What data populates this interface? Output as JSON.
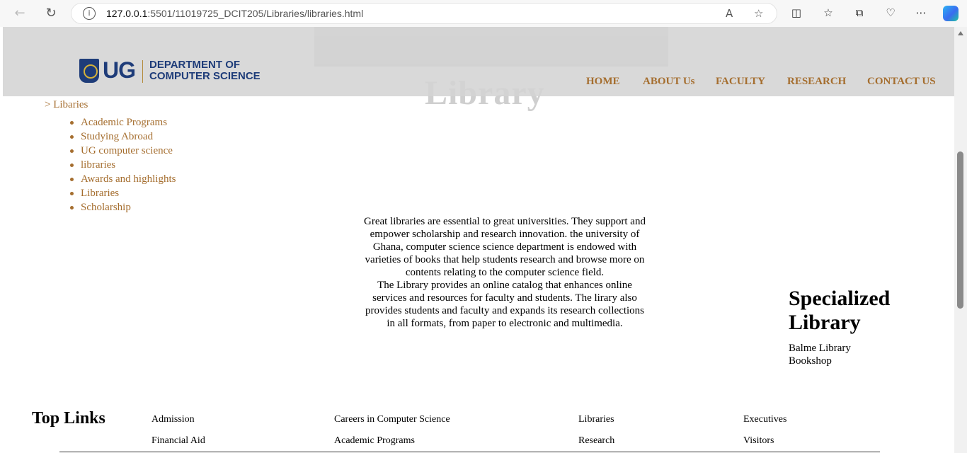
{
  "browser": {
    "url_host": "127.0.0.1",
    "url_path": ":5501/11019725_DCIT205/Libraries/libraries.html"
  },
  "header": {
    "logo_ug": "UG",
    "logo_dept_line1": "DEPARTMENT OF",
    "logo_dept_line2": "COMPUTER SCIENCE",
    "hero_title": "Library",
    "menu": [
      "HOME",
      "ABOUT Us",
      "FACULTY",
      "RESEARCH",
      "CONTACT US"
    ]
  },
  "sidebar": {
    "crumb": "> Libaries",
    "items": [
      "Academic Programs",
      "Studying Abroad",
      "UG computer science",
      "libraries",
      "Awards and highlights",
      "Libraries",
      "Scholarship"
    ]
  },
  "main": {
    "paragraph1": "Great libraries are essential to great universities. They support and empower scholarship and research innovation. the university of Ghana, computer science science department is endowed with varieties of books that help students research and browse more on contents relating to the computer science field.",
    "paragraph2": "The Library provides an online catalog that enhances online services and resources for faculty and students. The lirary also provides students and faculty and expands its research collections in all formats, from paper to electronic and multimedia."
  },
  "specialized": {
    "title": "Specialized Library",
    "items": [
      "Balme Library",
      "Bookshop"
    ]
  },
  "footer": {
    "title": "Top Links",
    "col1": [
      "Admission",
      "Financial Aid"
    ],
    "col2": [
      "Careers in Computer Science",
      "Academic Programs"
    ],
    "col3": [
      "Libraries",
      "Research"
    ],
    "col4": [
      "Executives",
      "Visitors"
    ]
  },
  "colors": {
    "accent": "#a56e2f",
    "brand_blue": "#1e3c79"
  }
}
